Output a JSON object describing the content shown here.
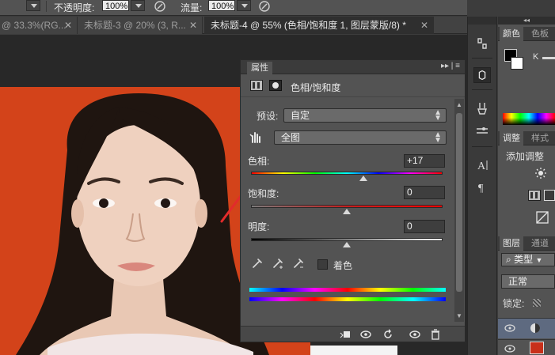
{
  "options_bar": {
    "opacity_label": "不透明度:",
    "opacity_value": "100%",
    "flow_label": "流量:",
    "flow_value": "100%"
  },
  "doc_tabs": [
    {
      "label": "@ 33.3%(RG..."
    },
    {
      "label": "未标题-3 @ 20% (3, R..."
    },
    {
      "label": "未标题-4 @ 55% (色相/饱和度 1, 图层蒙版/8) *"
    }
  ],
  "properties": {
    "panel_title": "属性",
    "adjustment_name": "色相/饱和度",
    "preset_label": "预设:",
    "preset_value": "自定",
    "channel_value": "全图",
    "hue_label": "色相:",
    "hue_value": "+17",
    "hue_position": 0.587,
    "saturation_label": "饱和度:",
    "saturation_value": "0",
    "saturation_position": 0.5,
    "lightness_label": "明度:",
    "lightness_value": "0",
    "lightness_position": 0.5,
    "colorize_label": "着色",
    "colorize_checked": false
  },
  "right_panel": {
    "color_tab": "颜色",
    "swatches_tab": "色板",
    "color_k_label": "K",
    "adjust_tab": "调整",
    "styles_tab": "样式",
    "add_adjustment": "添加调整",
    "layers_tab": "图层",
    "channels_tab": "通道",
    "filter_kind": "类型",
    "blend_mode": "正常",
    "lock_label": "锁定:"
  }
}
